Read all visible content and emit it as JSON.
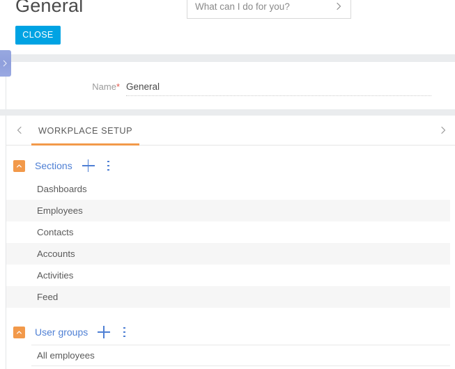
{
  "header": {
    "title": "General",
    "close_label": "CLOSE",
    "search": {
      "placeholder": "What can I do for you?",
      "value": "",
      "submit_icon": "chevron-right-icon"
    }
  },
  "side_tab": {
    "icon": "chevron-right-icon"
  },
  "form": {
    "fields": [
      {
        "label": "Name",
        "required_marker": "*",
        "value": "General"
      }
    ]
  },
  "tabbar": {
    "prev_icon": "chevron-left-icon",
    "next_icon": "chevron-right-icon",
    "tabs": [
      {
        "label": "WORKPLACE SETUP",
        "active": true
      }
    ]
  },
  "sections_group": {
    "collapse_icon": "chevron-up-icon",
    "title": "Sections",
    "add_icon": "plus-icon",
    "menu_icon": "vertical-ellipsis-icon",
    "items": [
      {
        "label": "Dashboards"
      },
      {
        "label": "Employees"
      },
      {
        "label": "Contacts"
      },
      {
        "label": "Accounts"
      },
      {
        "label": "Activities"
      },
      {
        "label": "Feed"
      }
    ]
  },
  "usergroups_group": {
    "collapse_icon": "chevron-up-icon",
    "title": "User groups",
    "add_icon": "plus-icon",
    "menu_icon": "vertical-ellipsis-icon",
    "items": [
      {
        "label": "All employees"
      }
    ]
  },
  "colors": {
    "accent_blue": "#00a3e3",
    "link_blue": "#4e7fd4",
    "accent_orange": "#f2994a",
    "required_red": "#e2574c",
    "band_gray": "#eaecee",
    "row_alt_gray": "#f6f6f6",
    "side_tab_purple": "#97a8e0"
  }
}
